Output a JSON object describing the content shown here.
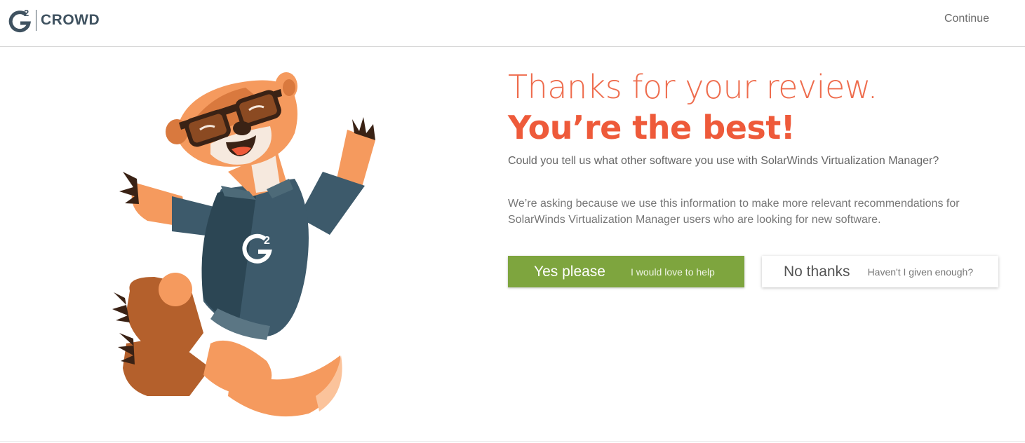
{
  "header": {
    "logo": {
      "mark": "G",
      "superscript": "2",
      "wordmark": "CROWD"
    },
    "continue_label": "Continue"
  },
  "main": {
    "headline_line1": "Thanks for your review.",
    "headline_line2": "You’re the best!",
    "question": "Could you tell us what other software you use with SolarWinds Virtualization Manager?",
    "explanation": "We’re asking because we use this information to make more relevant recommendations for SolarWinds Virtualization Manager users who are looking for new software.",
    "yes_button": {
      "label": "Yes please",
      "sublabel": "I would love to help"
    },
    "no_button": {
      "label": "No thanks",
      "sublabel": "Haven't I given enough?"
    }
  },
  "mascot": {
    "shirt_mark": "G",
    "shirt_superscript": "2"
  },
  "colors": {
    "accent_orange": "#ee5a3a",
    "yes_green": "#7ea53e",
    "logo_slate": "#3f5260",
    "mascot_shirt": "#3d5a6b"
  },
  "icons": [
    "g2-crowd-logo-icon",
    "mascot-illustration"
  ]
}
